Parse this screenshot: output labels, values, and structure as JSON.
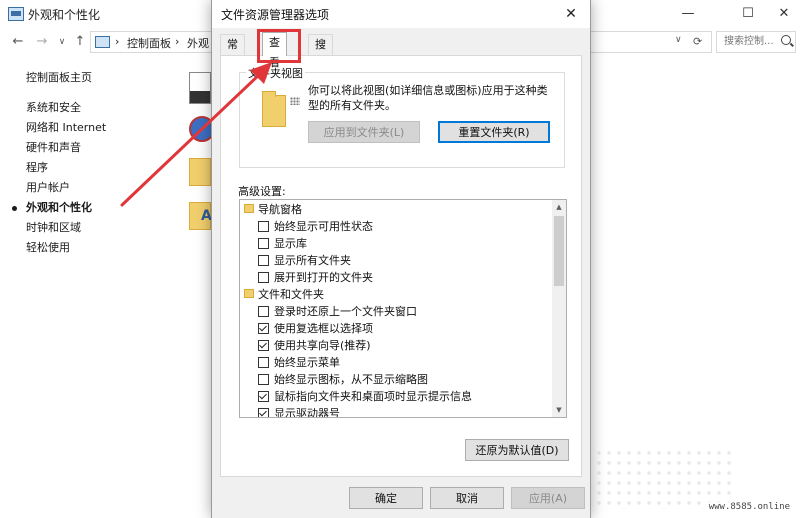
{
  "background_window": {
    "title": "外观和个性化",
    "controls": {
      "minimize": "—",
      "maximize": "☐",
      "close": "✕"
    },
    "nav": {
      "back": "←",
      "forward": "→",
      "dropdown": "∨",
      "up": "↑",
      "refresh": "⟳",
      "addr_dropdown": "∨"
    },
    "address": {
      "separator": "›",
      "seg1": "控制面板",
      "seg2": "外观"
    },
    "search": {
      "placeholder": "搜索控制..."
    },
    "side_nav": [
      {
        "label": "控制面板主页"
      },
      {
        "label": "系统和安全"
      },
      {
        "label": "网络和 Internet"
      },
      {
        "label": "硬件和声音"
      },
      {
        "label": "程序"
      },
      {
        "label": "用户帐户"
      },
      {
        "label": "外观和个性化",
        "active": true
      },
      {
        "label": "时钟和区域"
      },
      {
        "label": "轻松使用"
      }
    ],
    "partial_icon_text": "A"
  },
  "dialog": {
    "title": "文件资源管理器选项",
    "close": "✕",
    "tabs": [
      {
        "label": "常规"
      },
      {
        "label": "查看",
        "active": true
      },
      {
        "label": "搜索"
      }
    ],
    "folder_views": {
      "group_label": "文件夹视图",
      "description": "你可以将此视图(如详细信息或图标)应用于这种类型的所有文件夹。",
      "apply_button": "应用到文件夹(L)",
      "reset_button": "重置文件夹(R)"
    },
    "advanced_label": "高级设置:",
    "advanced_items": [
      {
        "type": "folder",
        "label": "导航窗格"
      },
      {
        "type": "checkbox",
        "checked": false,
        "label": "始终显示可用性状态"
      },
      {
        "type": "checkbox",
        "checked": false,
        "label": "显示库"
      },
      {
        "type": "checkbox",
        "checked": false,
        "label": "显示所有文件夹"
      },
      {
        "type": "checkbox",
        "checked": false,
        "label": "展开到打开的文件夹"
      },
      {
        "type": "folder",
        "label": "文件和文件夹"
      },
      {
        "type": "checkbox",
        "checked": false,
        "label": "登录时还原上一个文件夹窗口"
      },
      {
        "type": "checkbox",
        "checked": true,
        "label": "使用复选框以选择项"
      },
      {
        "type": "checkbox",
        "checked": true,
        "label": "使用共享向导(推荐)"
      },
      {
        "type": "checkbox",
        "checked": false,
        "label": "始终显示菜单"
      },
      {
        "type": "checkbox",
        "checked": false,
        "label": "始终显示图标，从不显示缩略图"
      },
      {
        "type": "checkbox",
        "checked": true,
        "label": "鼠标指向文件夹和桌面项时显示提示信息"
      },
      {
        "type": "checkbox",
        "checked": true,
        "label": "显示驱动器号"
      }
    ],
    "scroll": {
      "up": "▲",
      "down": "▼"
    },
    "restore_defaults": "还原为默认值(D)",
    "ok": "确定",
    "cancel": "取消",
    "apply": "应用(A)"
  },
  "watermark": "www.8585.online",
  "colors": {
    "annotation": "#e0363a",
    "accent": "#0078d7"
  }
}
